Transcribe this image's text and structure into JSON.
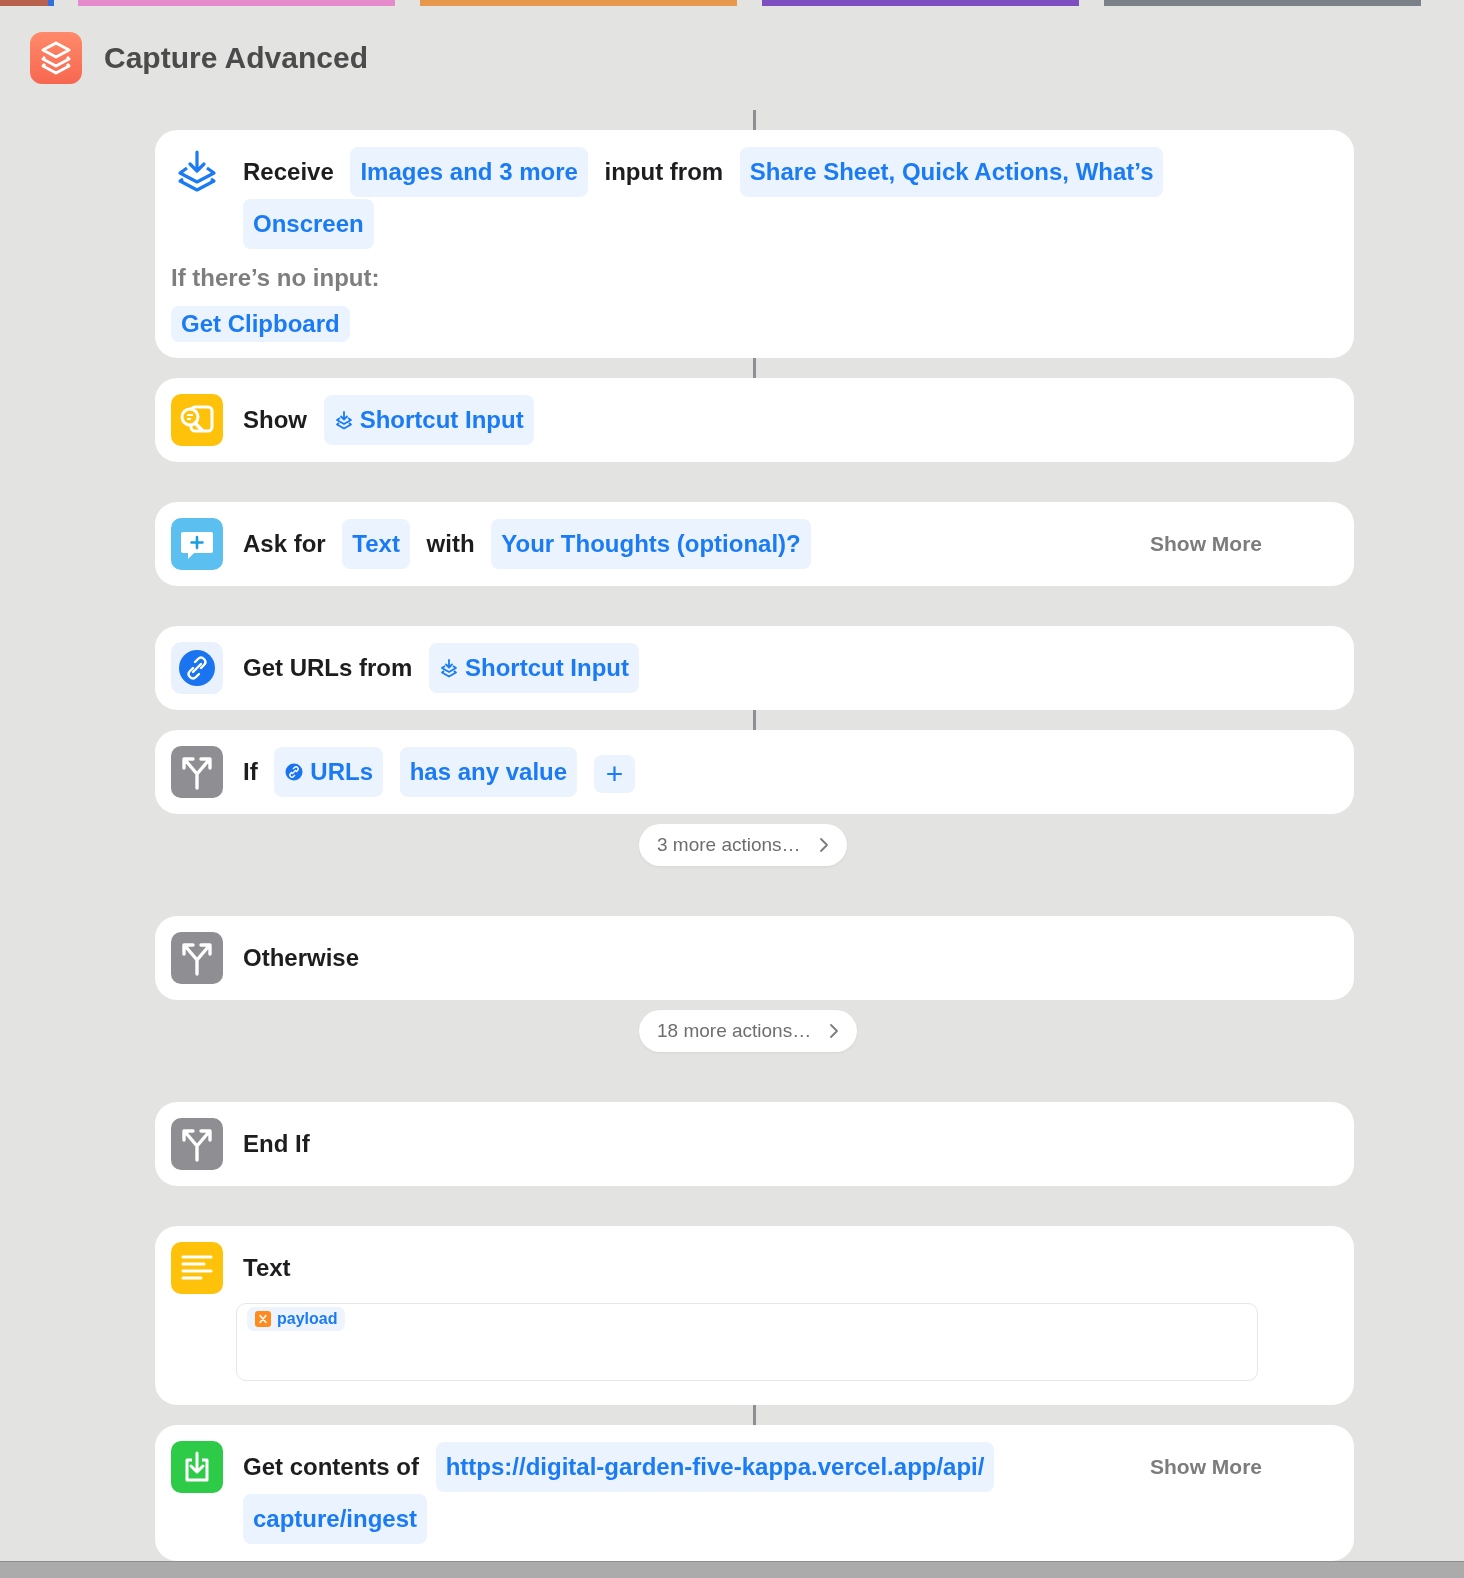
{
  "tab_strips": [
    {
      "color": "#b9614d"
    },
    {
      "color": "#2f6fde"
    },
    {
      "color": "#e58acb"
    },
    {
      "color": "#e8984c"
    },
    {
      "color": "#7e4fc0"
    },
    {
      "color": "#7b8189"
    }
  ],
  "window": {
    "title": "Capture Advanced"
  },
  "actions": [
    {
      "kind": "receive",
      "connected": true,
      "parts": [
        {
          "kind": "word",
          "text": "Receive"
        },
        {
          "kind": "token",
          "lines": [
            "Images and 3 more"
          ]
        },
        {
          "kind": "word",
          "text": "input from"
        },
        {
          "kind": "token",
          "lines": [
            "Share Sheet, Quick Actions, What’s",
            "Onscreen"
          ]
        }
      ],
      "fallback": {
        "label": "If there’s no input:",
        "token": "Get Clipboard"
      }
    },
    {
      "kind": "show",
      "connected": true,
      "parts": [
        {
          "kind": "word",
          "text": "Show"
        },
        {
          "kind": "shortcut_token",
          "lines": [
            "Shortcut Input"
          ]
        }
      ]
    },
    {
      "kind": "ask",
      "connected": false,
      "parts": [
        {
          "kind": "word",
          "text": "Ask for"
        },
        {
          "kind": "token",
          "lines": [
            "Text"
          ]
        },
        {
          "kind": "word",
          "text": "with"
        },
        {
          "kind": "token",
          "lines": [
            "Your Thoughts (optional)?"
          ]
        }
      ],
      "show_more": "Show More"
    },
    {
      "kind": "urls",
      "connected": false,
      "parts": [
        {
          "kind": "word",
          "text": "Get URLs from"
        },
        {
          "kind": "shortcut_token",
          "lines": [
            "Shortcut Input"
          ]
        }
      ]
    },
    {
      "kind": "branch",
      "connected": true,
      "parts": [
        {
          "kind": "word",
          "text": "If"
        },
        {
          "kind": "link_token",
          "lines": [
            "URLs"
          ]
        },
        {
          "kind": "token",
          "lines": [
            "has any value"
          ]
        },
        {
          "kind": "add",
          "text": "+"
        }
      ]
    },
    {
      "kind": "more",
      "label": "3 more actions…"
    },
    {
      "kind": "branch",
      "connected": false,
      "parts": [
        {
          "kind": "word",
          "text": "Otherwise"
        }
      ]
    },
    {
      "kind": "more",
      "label": "18 more actions…"
    },
    {
      "kind": "branch",
      "connected": false,
      "parts": [
        {
          "kind": "word",
          "text": "End If"
        }
      ]
    },
    {
      "kind": "text",
      "connected": false,
      "parts": [
        {
          "kind": "word",
          "text": "Text"
        }
      ],
      "field": {
        "tokens": [
          {
            "kind": "variable",
            "text": "payload"
          }
        ]
      }
    },
    {
      "kind": "download",
      "connected": true,
      "parts": [
        {
          "kind": "word",
          "text": "Get contents of"
        },
        {
          "kind": "token",
          "lines": [
            "https://digital-garden-five-kappa.vercel.app/api/",
            "capture/ingest"
          ]
        }
      ],
      "show_more": "Show More"
    }
  ]
}
